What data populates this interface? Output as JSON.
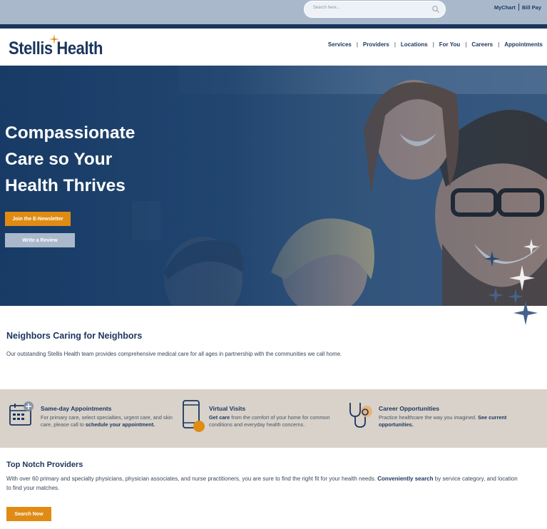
{
  "topbar": {
    "search_placeholder": "Search here...",
    "links": [
      "MyChart",
      "Bill Pay"
    ]
  },
  "header": {
    "logo": "Stellis Health",
    "nav": [
      "Services",
      "Providers",
      "Locations",
      "For You",
      "Careers",
      "Appointments"
    ]
  },
  "hero": {
    "title_lines": [
      "Compassionate",
      "Care so Your",
      "Health Thrives"
    ],
    "newsletter_button": "Join the E-Newsletter",
    "review_button": "Write a Review"
  },
  "intro": {
    "title": "Neighbors Caring for Neighbors",
    "text": "Our outstanding Stellis Health team provides comprehensive medical care for all ages in partnership with the communities we call home."
  },
  "features": [
    {
      "title": "Same-day Appointments",
      "text_before": "For primary care, select specialties, urgent care, and skin care, please call to ",
      "text_bold": "schedule your appointment.",
      "text_after": "",
      "icon": "calendar-icon"
    },
    {
      "title": "Virtual Visits",
      "text_bold": "Get care",
      "text_after": " from the comfort of your home for common conditions and everyday health concerns.",
      "icon": "phone-icon"
    },
    {
      "title": "Career Opportunities",
      "text_before": "Practice healthcare the way you imagined. ",
      "text_bold": "See current opportunities.",
      "icon": "stethoscope-icon"
    }
  ],
  "providers": {
    "title": "Top Notch Providers",
    "text_before": "With over 60 primary and specialty physicians, physician associates, and nurse practitioners, you are sure to find the right fit for your health needs. ",
    "text_bold": "Conveniently search",
    "text_after": " by service category, and location to find your matches.",
    "search_button": "Search Now"
  },
  "colors": {
    "navy": "#1b365d",
    "orange": "#e08b14",
    "topbar": "#a9b9cb",
    "band": "#d8d2ca"
  }
}
